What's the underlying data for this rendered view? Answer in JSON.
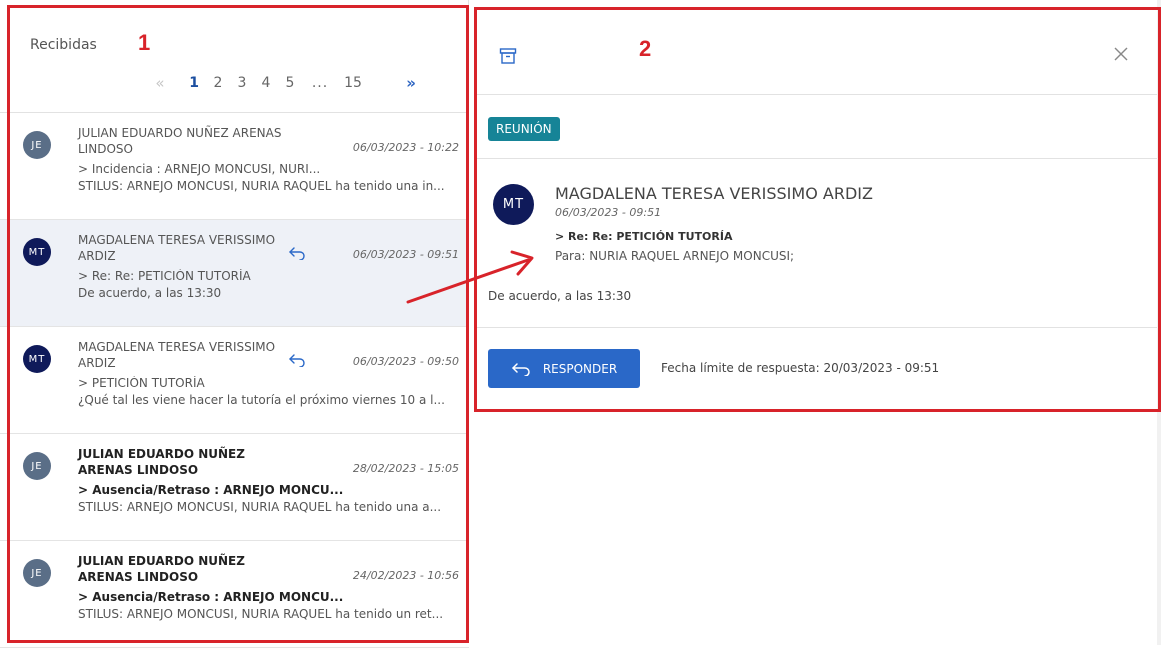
{
  "inbox": {
    "title": "Recibidas",
    "pagination": {
      "prev": "«",
      "pages": [
        "1",
        "2",
        "3",
        "4",
        "5"
      ],
      "ellipsis": "...",
      "last": "15",
      "next": "»",
      "current": "1"
    }
  },
  "messages": [
    {
      "initials": "JE",
      "sender": "JULIAN EDUARDO NUÑEZ ARENAS LINDOSO",
      "date": "06/03/2023 - 10:22",
      "subject": "> Incidencia : ARNEJO MONCUSI, NURI...",
      "preview": "STILUS: ARNEJO MONCUSI, NURIA RAQUEL ha tenido una in...",
      "replied": false,
      "unread": false,
      "selected": false
    },
    {
      "initials": "MT",
      "sender": "MAGDALENA TERESA VERISSIMO ARDIZ",
      "date": "06/03/2023 - 09:51",
      "subject": "> Re: Re: PETICIÓN TUTORÍA",
      "preview": "De acuerdo, a las 13:30",
      "replied": true,
      "unread": false,
      "selected": true
    },
    {
      "initials": "MT",
      "sender": "MAGDALENA TERESA VERISSIMO ARDIZ",
      "date": "06/03/2023 - 09:50",
      "subject": "> PETICIÓN TUTORÍA",
      "preview": "¿Qué tal les viene hacer la tutoría el próximo viernes 10 a l...",
      "replied": true,
      "unread": false,
      "selected": false
    },
    {
      "initials": "JE",
      "sender": "JULIAN EDUARDO NUÑEZ ARENAS LINDOSO",
      "date": "28/02/2023 - 15:05",
      "subject": "> Ausencia/Retraso : ARNEJO MONCU...",
      "preview": "STILUS: ARNEJO MONCUSI, NURIA RAQUEL ha tenido una a...",
      "replied": false,
      "unread": true,
      "selected": false
    },
    {
      "initials": "JE",
      "sender": "JULIAN EDUARDO NUÑEZ ARENAS LINDOSO",
      "date": "24/02/2023 - 10:56",
      "subject": "> Ausencia/Retraso : ARNEJO MONCU...",
      "preview": "STILUS: ARNEJO MONCUSI, NURIA RAQUEL ha tenido un ret...",
      "replied": false,
      "unread": true,
      "selected": false
    }
  ],
  "detail": {
    "tag": "REUNIÓN",
    "avatar_initials": "MT",
    "sender": "MAGDALENA TERESA VERISSIMO ARDIZ",
    "date": "06/03/2023 - 09:51",
    "subject": "> Re: Re: PETICIÓN TUTORÍA",
    "to": "Para: NURIA RAQUEL ARNEJO MONCUSI;",
    "body": "De acuerdo, a las 13:30",
    "reply_label": "RESPONDER",
    "deadline": "Fecha límite de respuesta: 20/03/2023 - 09:51"
  },
  "annotations": {
    "label_1": "1",
    "label_2": "2"
  },
  "colors": {
    "annotation": "#d8232a",
    "primary": "#2a68c8",
    "tag": "#168497",
    "avatar_je": "#5a6e87",
    "avatar_mt": "#0f1a5a",
    "selected_row": "#eef1f7"
  },
  "icons": {
    "archive": "archive-icon",
    "close": "close-icon",
    "reply": "reply-icon"
  }
}
